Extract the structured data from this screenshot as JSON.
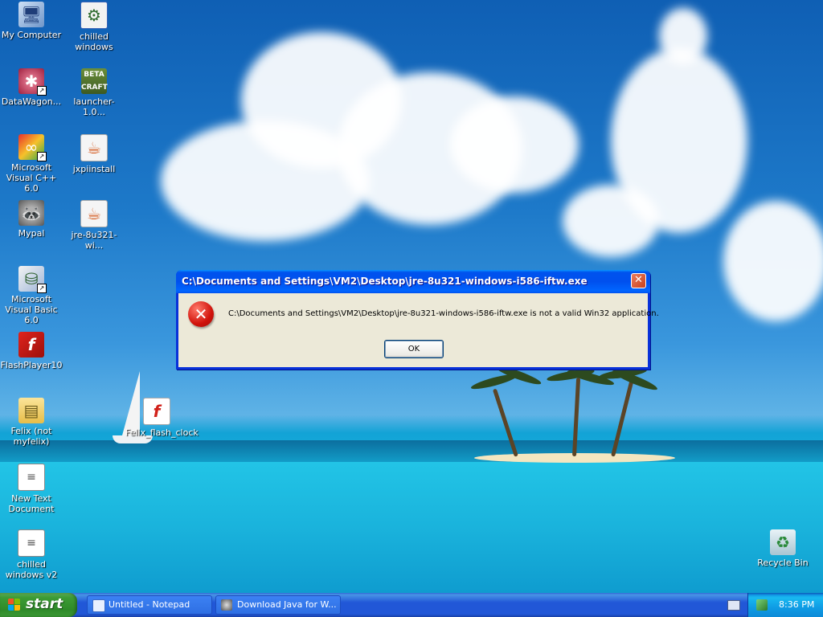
{
  "desktop": {
    "icons": [
      {
        "label": "My Computer"
      },
      {
        "label": "chilled windows"
      },
      {
        "label": "DataWagon..."
      },
      {
        "label": "launcher-1.0..."
      },
      {
        "label": "Microsoft Visual C++ 6.0"
      },
      {
        "label": "jxpiinstall"
      },
      {
        "label": "Mypal"
      },
      {
        "label": "jre-8u321-wi..."
      },
      {
        "label": "Microsoft Visual Basic 6.0"
      },
      {
        "label": "FlashPlayer10"
      },
      {
        "label": "Felix (not myfelix)"
      },
      {
        "label": "Felix_flash_clock"
      },
      {
        "label": "New Text Document"
      },
      {
        "label": "chilled windows v2"
      },
      {
        "label": "Recycle Bin"
      }
    ]
  },
  "dialog": {
    "title": "C:\\Documents and Settings\\VM2\\Desktop\\jre-8u321-windows-i586-iftw.exe",
    "message": "C:\\Documents and Settings\\VM2\\Desktop\\jre-8u321-windows-i586-iftw.exe is not a valid Win32 application.",
    "ok_label": "OK",
    "close_glyph": "✕",
    "icon": "error-icon"
  },
  "taskbar": {
    "start_label": "start",
    "items": [
      {
        "label": "Untitled - Notepad",
        "icon": "notepad-icon"
      },
      {
        "label": "Download Java for W...",
        "icon": "mypal-icon"
      }
    ],
    "clock": "8:36 PM"
  },
  "colors": {
    "titlebar": "#0053ee",
    "dialog_bg": "#ece9d8",
    "start_green": "#3c9b35",
    "taskbar_blue": "#2157d7",
    "tray_blue": "#0f9ce5"
  }
}
